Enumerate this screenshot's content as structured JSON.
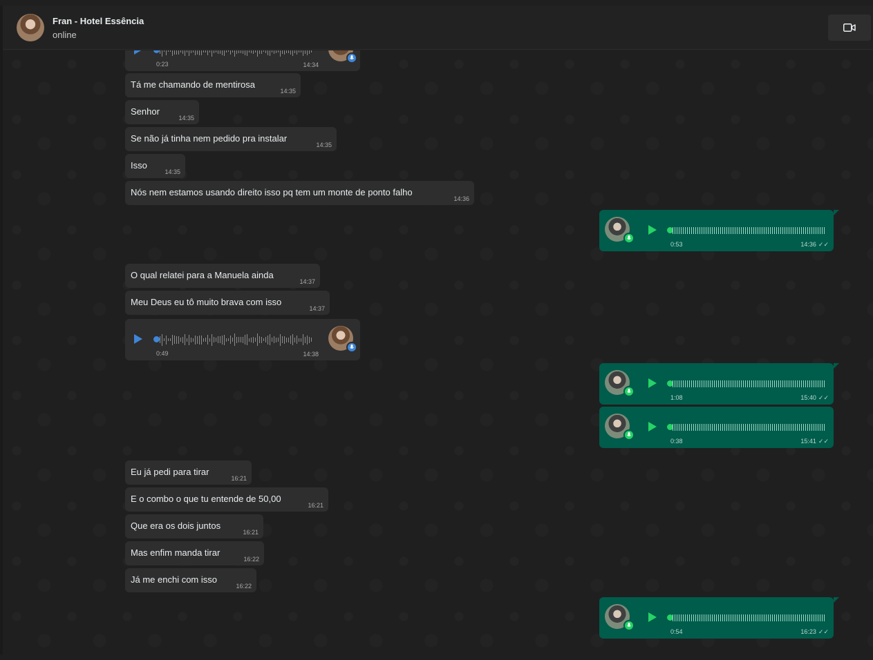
{
  "header": {
    "contact_name": "Fran - Hotel Essência",
    "status": "online"
  },
  "messages": {
    "voice_top": {
      "duration": "0:23",
      "time": "14:34"
    },
    "m1": {
      "text": "Tá me chamando de mentirosa",
      "time": "14:35"
    },
    "m2": {
      "text": "Senhor",
      "time": "14:35"
    },
    "m3": {
      "text": "Se não já tinha nem pedido pra instalar",
      "time": "14:35"
    },
    "m4": {
      "text": "Isso",
      "time": "14:35"
    },
    "m5": {
      "text": "Nós nem estamos usando direito isso pq tem um monte de ponto falho",
      "time": "14:36"
    },
    "out1": {
      "duration": "0:53",
      "time": "14:36"
    },
    "m6": {
      "text": "O qual relatei para a Manuela ainda",
      "time": "14:37"
    },
    "m7": {
      "text": "Meu Deus eu tô muito brava com isso",
      "time": "14:37"
    },
    "voice_in2": {
      "duration": "0:49",
      "time": "14:38"
    },
    "out2": {
      "duration": "1:08",
      "time": "15:40"
    },
    "out3": {
      "duration": "0:38",
      "time": "15:41"
    },
    "m8": {
      "text": "Eu já pedi para tirar",
      "time": "16:21"
    },
    "m9": {
      "text": "E o combo o que tu entende de 50,00",
      "time": "16:21"
    },
    "m10": {
      "text": "Que era os dois juntos",
      "time": "16:21"
    },
    "m11": {
      "text": "Mas enfim manda tirar",
      "time": "16:22"
    },
    "m12": {
      "text": "Já me enchi com isso",
      "time": "16:22"
    },
    "out4": {
      "duration": "0:54",
      "time": "16:23"
    }
  },
  "icons": {
    "video": "video-camera-icon",
    "play": "play-icon",
    "mic": "microphone-icon",
    "read": "double-check-icon"
  },
  "colors": {
    "incoming_bubble": "#2e2e2e",
    "outgoing_bubble": "#005c4b",
    "accent_blue": "#3f86d8",
    "accent_green": "#25d366"
  }
}
